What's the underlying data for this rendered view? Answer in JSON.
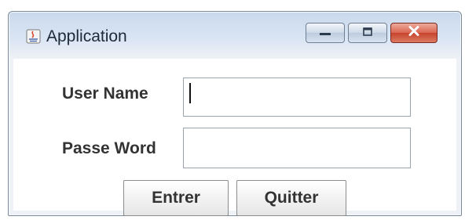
{
  "window": {
    "title": "Application",
    "icon": "java-app-icon",
    "controls": [
      "minimize-icon",
      "maximize-icon",
      "close-icon"
    ]
  },
  "form": {
    "username_label": "User Name",
    "username_value": "",
    "password_label": "Passe Word",
    "password_value": ""
  },
  "buttons": {
    "enter_label": "Entrer",
    "quit_label": "Quitter"
  },
  "colors": {
    "close_button": "#c7432c",
    "title_gradient_top": "#c9d9ec",
    "text": "#333333"
  }
}
